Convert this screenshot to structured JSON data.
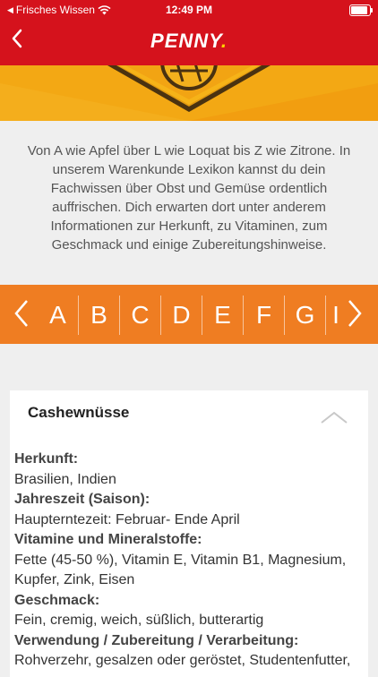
{
  "status_bar": {
    "carrier": "Frisches Wissen",
    "time": "12:49 PM"
  },
  "header": {
    "logo_text": "PENNY",
    "logo_dot": "."
  },
  "intro_text": "Von A wie Apfel über L wie Loquat bis Z wie Zitrone. In unserem Warenkunde Lexikon kannst du dein Fachwissen über Obst und Gemüse ordentlich auffrischen. Dich erwarten dort unter anderem Informationen zur Herkunft, zu Vitaminen, zum Geschmack und einige Zubereitungshinweise.",
  "alphabet": {
    "letters": [
      "A",
      "B",
      "C",
      "D",
      "E",
      "F",
      "G",
      "I"
    ]
  },
  "card": {
    "title": "Cashewnüsse",
    "sections": [
      {
        "heading": "Herkunft:",
        "lines": [
          "Brasilien, Indien"
        ]
      },
      {
        "heading": "Jahreszeit (Saison):",
        "lines": [
          "Haupterntezeit: Februar- Ende April"
        ]
      },
      {
        "heading": "Vitamine und Mineralstoffe:",
        "lines": [
          "Fette (45-50 %), Vitamin E, Vitamin B1, Magnesium,",
          "Kupfer, Zink, Eisen"
        ]
      },
      {
        "heading": "Geschmack:",
        "lines": [
          "Fein, cremig, weich, süßlich, butterartig"
        ]
      },
      {
        "heading": "Verwendung / Zubereitung / Verarbeitung:",
        "lines": [
          "Rohverzehr, gesalzen oder geröstet, Studentenfutter,"
        ]
      }
    ]
  },
  "colors": {
    "brand_red": "#d5121c",
    "accent_orange": "#ef7d22",
    "banner_yellow": "#f2a413"
  }
}
